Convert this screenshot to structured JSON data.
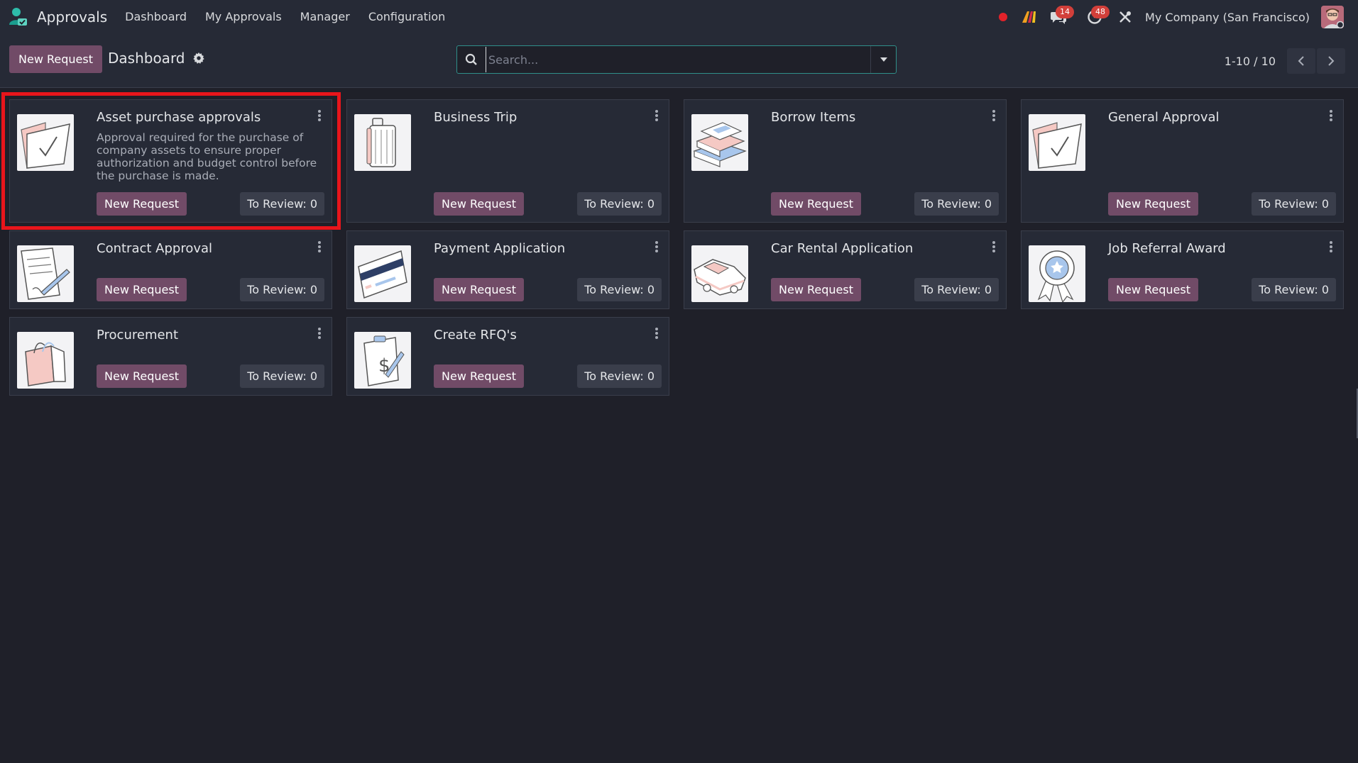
{
  "navbar": {
    "app_name": "Approvals",
    "menu": [
      "Dashboard",
      "My Approvals",
      "Manager",
      "Configuration"
    ],
    "messages_count": "14",
    "activities_count": "48",
    "company": "My Company (San Francisco)"
  },
  "control_panel": {
    "new_request_label": "New Request",
    "breadcrumb": "Dashboard",
    "search_placeholder": "Search...",
    "pager": "1-10 / 10"
  },
  "cards": [
    {
      "title": "Asset purchase approvals",
      "description": "Approval required for the purchase of company assets to ensure proper authorization and budget control before the purchase is made.",
      "new_label": "New Request",
      "review_label": "To Review: 0",
      "icon": "folder-check-icon"
    },
    {
      "title": "Business Trip",
      "description": "",
      "new_label": "New Request",
      "review_label": "To Review: 0",
      "icon": "luggage-icon"
    },
    {
      "title": "Borrow Items",
      "description": "",
      "new_label": "New Request",
      "review_label": "To Review: 0",
      "icon": "books-icon"
    },
    {
      "title": "General Approval",
      "description": "",
      "new_label": "New Request",
      "review_label": "To Review: 0",
      "icon": "folder-check-icon"
    },
    {
      "title": "Contract Approval",
      "description": "",
      "new_label": "New Request",
      "review_label": "To Review: 0",
      "icon": "contract-pen-icon"
    },
    {
      "title": "Payment Application",
      "description": "",
      "new_label": "New Request",
      "review_label": "To Review: 0",
      "icon": "credit-card-icon"
    },
    {
      "title": "Car Rental Application",
      "description": "",
      "new_label": "New Request",
      "review_label": "To Review: 0",
      "icon": "car-icon"
    },
    {
      "title": "Job Referral Award",
      "description": "",
      "new_label": "New Request",
      "review_label": "To Review: 0",
      "icon": "award-ribbon-icon"
    },
    {
      "title": "Procurement",
      "description": "",
      "new_label": "New Request",
      "review_label": "To Review: 0",
      "icon": "shopping-bag-icon"
    },
    {
      "title": "Create RFQ's",
      "description": "",
      "new_label": "New Request",
      "review_label": "To Review: 0",
      "icon": "invoice-dollar-icon"
    }
  ],
  "colors": {
    "primary": "#714b67",
    "background": "#1f2029",
    "panel": "#262a36",
    "highlight": "#e8151b",
    "badge": "#d23f3a"
  }
}
